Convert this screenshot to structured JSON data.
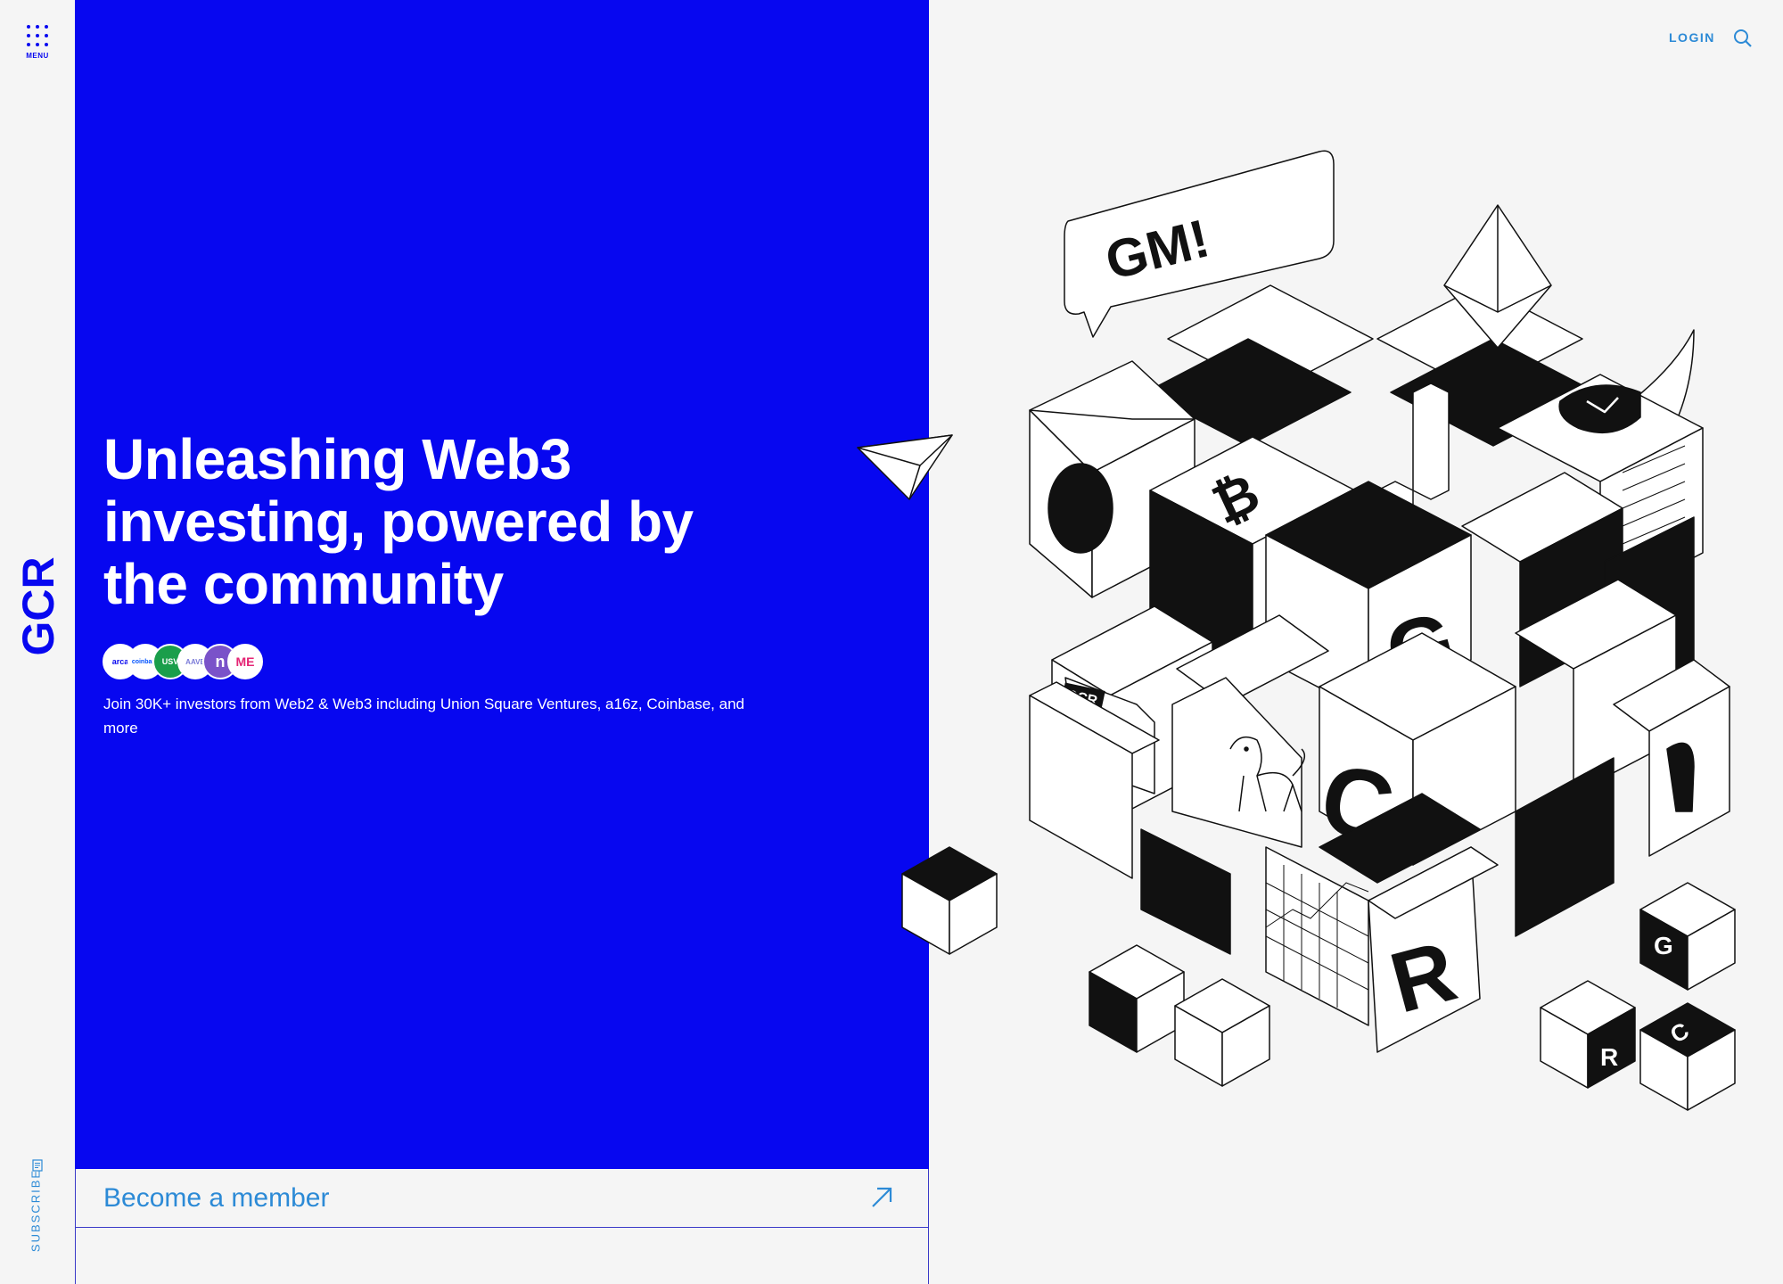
{
  "nav": {
    "menu_label": "MENU",
    "login_label": "LOGIN",
    "subscribe_label": "SUBSCRIBE",
    "logo_text": "GCR"
  },
  "hero": {
    "title": "Unleashing Web3 investing, powered by the community",
    "subtitle": "Join 30K+ investors from Web2 & Web3 including Union Square Ventures, a16z, Coinbase, and more",
    "partners": [
      {
        "name": "arca",
        "bg": "#ffffff",
        "fg": "#0707f0"
      },
      {
        "name": "coinbase",
        "bg": "#ffffff",
        "fg": "#0052ff"
      },
      {
        "name": "USV",
        "bg": "#1a9e4b",
        "fg": "#ffffff"
      },
      {
        "name": "AAVE",
        "bg": "#ffffff",
        "fg": "#7a7ad8"
      },
      {
        "name": "n",
        "bg": "#7a52c9",
        "fg": "#ffffff"
      },
      {
        "name": "ME",
        "bg": "#ffffff",
        "fg": "#e42575"
      }
    ]
  },
  "cta": {
    "member_label": "Become a member"
  },
  "illustration": {
    "speech_bubble": "GM!",
    "doc_label": "GCR",
    "letters": [
      "G",
      "C",
      "R"
    ]
  },
  "colors": {
    "brand_blue": "#0707f0",
    "link_blue": "#2c8ad6",
    "background": "#f5f5f5"
  }
}
